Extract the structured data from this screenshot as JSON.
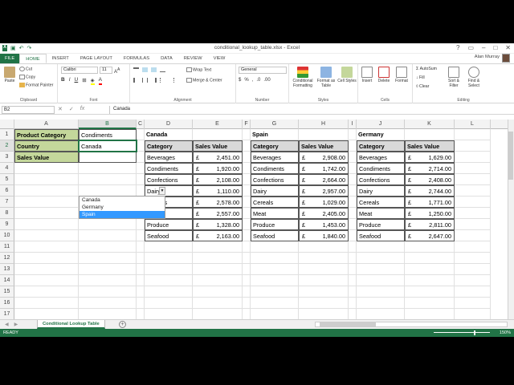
{
  "window": {
    "title": "conditional_lookup_table.xlsx - Excel",
    "user": "Alan Murray"
  },
  "tabs": [
    "FILE",
    "HOME",
    "INSERT",
    "PAGE LAYOUT",
    "FORMULAS",
    "DATA",
    "REVIEW",
    "VIEW"
  ],
  "ribbon": {
    "clipboard": {
      "paste": "Paste",
      "cut": "Cut",
      "copy": "Copy",
      "painter": "Format Painter",
      "label": "Clipboard"
    },
    "font": {
      "name": "Calibri",
      "size": "11",
      "label": "Font"
    },
    "alignment": {
      "wrap": "Wrap Text",
      "merge": "Merge & Center",
      "label": "Alignment"
    },
    "number": {
      "format": "General",
      "label": "Number"
    },
    "styles": {
      "cond": "Conditional Formatting",
      "table": "Format as Table",
      "cell": "Cell Styles",
      "label": "Styles"
    },
    "cells": {
      "insert": "Insert",
      "delete": "Delete",
      "format": "Format",
      "label": "Cells"
    },
    "editing": {
      "autosum": "AutoSum",
      "fill": "Fill",
      "clear": "Clear",
      "sort": "Sort & Filter",
      "find": "Find & Select",
      "label": "Editing"
    }
  },
  "formula_bar": {
    "name_box": "B2",
    "fx": "fx",
    "value": "Canada"
  },
  "columns": [
    "A",
    "B",
    "C",
    "D",
    "E",
    "F",
    "G",
    "H",
    "I",
    "J",
    "K",
    "L"
  ],
  "rows": [
    "1",
    "2",
    "3",
    "4",
    "5",
    "6",
    "7",
    "8",
    "9",
    "10",
    "11",
    "12",
    "13",
    "14",
    "15",
    "16",
    "17"
  ],
  "lookup": {
    "a1": "Product Category",
    "b1": "Condiments",
    "a2": "Country",
    "b2": "Canada",
    "a3": "Sales Value"
  },
  "dropdown": {
    "options": [
      "Canada",
      "Germany",
      "Spain"
    ],
    "highlighted": "Spain"
  },
  "tables": [
    {
      "country": "Canada",
      "h1": "Category",
      "h2": "Sales Value",
      "rows": [
        [
          "Beverages",
          "2,451.00"
        ],
        [
          "Condiments",
          "1,920.00"
        ],
        [
          "Confections",
          "2,108.00"
        ],
        [
          "Dairy",
          "1,110.00"
        ],
        [
          "Cereals",
          "2,578.00"
        ],
        [
          "Meat",
          "2,557.00"
        ],
        [
          "Produce",
          "1,328.00"
        ],
        [
          "Seafood",
          "2,163.00"
        ]
      ]
    },
    {
      "country": "Spain",
      "h1": "Category",
      "h2": "Sales Value",
      "rows": [
        [
          "Beverages",
          "2,908.00"
        ],
        [
          "Condiments",
          "1,742.00"
        ],
        [
          "Confections",
          "2,664.00"
        ],
        [
          "Dairy",
          "2,957.00"
        ],
        [
          "Cereals",
          "1,029.00"
        ],
        [
          "Meat",
          "2,405.00"
        ],
        [
          "Produce",
          "1,453.00"
        ],
        [
          "Seafood",
          "1,840.00"
        ]
      ]
    },
    {
      "country": "Germany",
      "h1": "Category",
      "h2": "Sales Value",
      "rows": [
        [
          "Beverages",
          "1,629.00"
        ],
        [
          "Condiments",
          "2,714.00"
        ],
        [
          "Confections",
          "2,408.00"
        ],
        [
          "Dairy",
          "2,744.00"
        ],
        [
          "Cereals",
          "1,771.00"
        ],
        [
          "Meat",
          "1,250.00"
        ],
        [
          "Produce",
          "2,811.00"
        ],
        [
          "Seafood",
          "2,647.00"
        ]
      ]
    }
  ],
  "currency": "£",
  "sheet_tab": "Conditional Lookup Table",
  "status": {
    "ready": "READY",
    "zoom": "150%"
  },
  "colors": {
    "accent": "#217346",
    "lookup_fill": "#c4d79b",
    "header_fill": "#d9d9d9"
  }
}
